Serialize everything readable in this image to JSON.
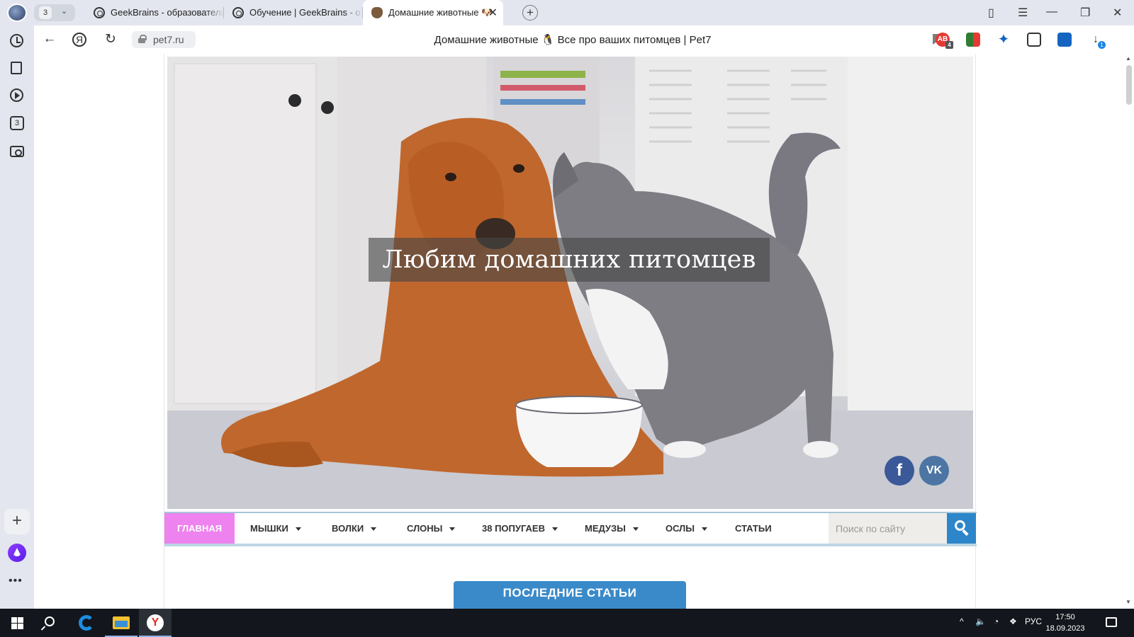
{
  "browser": {
    "tab_counter": "3",
    "tabs": [
      {
        "title": "GeekBrains - образовательн",
        "active": false,
        "favicon": "geekbrains-icon"
      },
      {
        "title": "Обучение | GeekBrains - о",
        "active": false,
        "favicon": "geekbrains-icon"
      },
      {
        "title": "Домашние животные 🐶",
        "active": true,
        "favicon": "pet7-icon",
        "close": "✕"
      }
    ],
    "new_tab": "+",
    "url": "pet7.ru",
    "page_title": "Домашние животные 🐧 Все про ваших питомцев | Pet7",
    "extensions": [
      {
        "name": "adblock-icon",
        "badge": "4"
      },
      {
        "name": "extension-icon",
        "badge": ""
      },
      {
        "name": "acrobat-icon",
        "badge": ""
      },
      {
        "name": "clipboard-icon",
        "badge": ""
      },
      {
        "name": "account-icon",
        "badge": ""
      },
      {
        "name": "downloads-icon",
        "badge": "1"
      }
    ]
  },
  "sidebar": {
    "items": [
      "history-icon",
      "notes-icon",
      "video-icon",
      "tabs-3-icon",
      "screenshot-icon"
    ],
    "tabs_count": "3"
  },
  "site": {
    "hero_title": "Любим домашних питомцев",
    "social": {
      "facebook": "f",
      "vk": "VK"
    },
    "menu": [
      {
        "label": "ГЛАВНАЯ",
        "dropdown": false,
        "active": true
      },
      {
        "label": "МЫШКИ",
        "dropdown": true
      },
      {
        "label": "ВОЛКИ",
        "dropdown": true
      },
      {
        "label": "СЛОНЫ",
        "dropdown": true
      },
      {
        "label": "38 ПОПУГАЕВ",
        "dropdown": true
      },
      {
        "label": "МЕДУЗЫ",
        "dropdown": true
      },
      {
        "label": "ОСЛЫ",
        "dropdown": true
      },
      {
        "label": "СТАТЬИ",
        "dropdown": false
      }
    ],
    "search_placeholder": "Поиск по сайту",
    "latest_button": "ПОСЛЕДНИЕ СТАТЬИ",
    "colors": {
      "menu_home": "#ee82ee",
      "search_button": "#2d86c9",
      "latest_button": "#3a8ac9"
    }
  },
  "taskbar": {
    "apps": [
      "edge-icon",
      "file-explorer-icon",
      "yandex-browser-icon"
    ],
    "language": "РУС",
    "time": "17:50",
    "date": "18.09.2023"
  }
}
